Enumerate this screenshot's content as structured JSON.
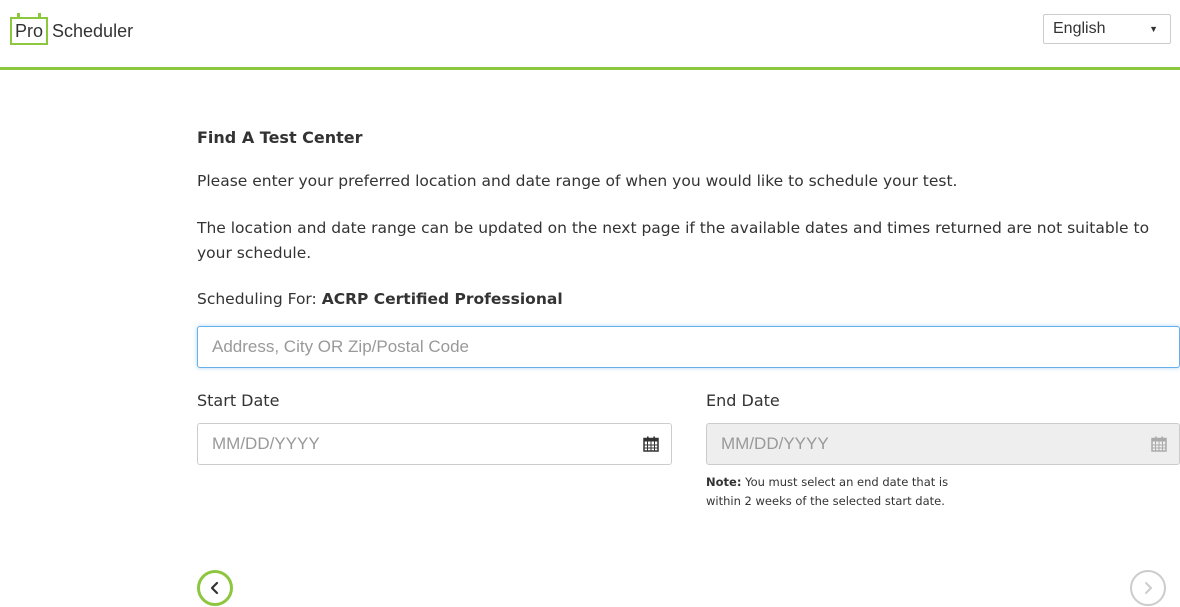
{
  "header": {
    "logo_pro": "Pro",
    "logo_scheduler": "Scheduler",
    "language": {
      "selected": "English"
    }
  },
  "main": {
    "title": "Find A Test Center",
    "intro": "Please enter your preferred location and date range of when you would like to schedule your test.",
    "info": "The location and date range can be updated on the next page if the available dates and times returned are not suitable to your schedule.",
    "scheduling_for_label": "Scheduling For:",
    "scheduling_for_value": "ACRP Certified Professional",
    "address_placeholder": "Address, City OR Zip/Postal Code",
    "start_date": {
      "label": "Start Date",
      "placeholder": "MM/DD/YYYY"
    },
    "end_date": {
      "label": "End Date",
      "placeholder": "MM/DD/YYYY",
      "disabled": true
    },
    "note_label": "Note:",
    "note_text": "You must select an end date that is within 2 weeks of the selected start date."
  },
  "icons": {
    "calendar": "calendar-icon",
    "prev": "chevron-left-icon",
    "next": "chevron-right-icon",
    "caret": "caret-down-icon"
  },
  "colors": {
    "brand_green": "#8dc63f",
    "focus_blue": "#66afe9",
    "disabled_gray": "#eeeeee",
    "text": "#333333",
    "placeholder": "#999999"
  }
}
